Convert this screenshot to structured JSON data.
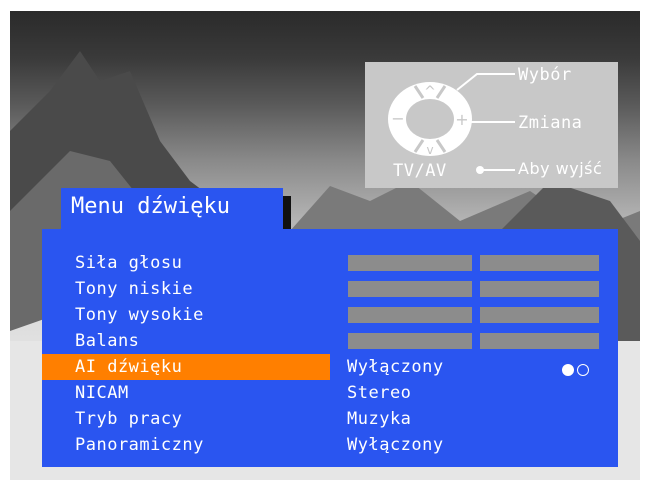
{
  "help": {
    "select": "Wybór",
    "change": "Zmiana",
    "exit_button": "TV/AV",
    "exit": "Aby wyjść"
  },
  "menu": {
    "title": "Menu dźwięku",
    "items": [
      {
        "label": "Siła głosu",
        "value": "",
        "type": "slider"
      },
      {
        "label": "Tony niskie",
        "value": "",
        "type": "slider"
      },
      {
        "label": "Tony wysokie",
        "value": "",
        "type": "slider"
      },
      {
        "label": "Balans",
        "value": "",
        "type": "slider"
      },
      {
        "label": "AI dźwięku",
        "value": "Wyłączony",
        "type": "option",
        "selected": true
      },
      {
        "label": "NICAM",
        "value": "Stereo",
        "type": "option"
      },
      {
        "label": "Tryb pracy",
        "value": "Muzyka",
        "type": "option"
      },
      {
        "label": "Panoramiczny",
        "value": "Wyłączony",
        "type": "option"
      }
    ]
  },
  "colors": {
    "panel": "#2a55f0",
    "highlight": "#ff7f00",
    "slider": "#8c8c8c",
    "help_bg": "#c8c8c8"
  },
  "icons": [
    "remote-dpad-icon",
    "toggle-dots-icon"
  ]
}
